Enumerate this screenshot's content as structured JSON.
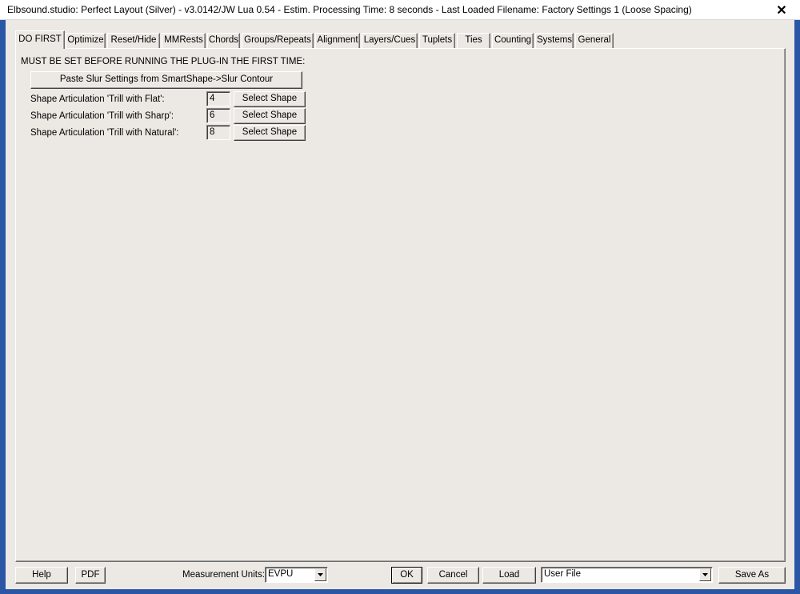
{
  "window": {
    "title": "Elbsound.studio: Perfect Layout (Silver) - v3.0142/JW Lua 0.54 - Estim. Processing Time: 8 seconds - Last Loaded Filename: Factory Settings 1 (Loose Spacing)",
    "close_glyph": "✕"
  },
  "tabs": [
    {
      "label": "DO FIRST",
      "active": true
    },
    {
      "label": "Optimize"
    },
    {
      "label": "Reset/Hide"
    },
    {
      "label": "MMRests"
    },
    {
      "label": "Chords"
    },
    {
      "label": "Groups/Repeats"
    },
    {
      "label": "Alignment"
    },
    {
      "label": "Layers/Cues"
    },
    {
      "label": "Tuplets"
    },
    {
      "label": "Ties"
    },
    {
      "label": "Counting"
    },
    {
      "label": "Systems"
    },
    {
      "label": "General"
    }
  ],
  "panel": {
    "header": "MUST BE SET BEFORE RUNNING THE PLUG-IN THE FIRST TIME:",
    "paste_button": "Paste Slur Settings from SmartShape->Slur Contour",
    "rows": [
      {
        "label": "Shape Articulation 'Trill with Flat':",
        "value": "4",
        "button": "Select Shape"
      },
      {
        "label": "Shape Articulation 'Trill with Sharp':",
        "value": "6",
        "button": "Select Shape"
      },
      {
        "label": "Shape Articulation 'Trill with Natural':",
        "value": "8",
        "button": "Select Shape"
      }
    ]
  },
  "footer": {
    "help": "Help",
    "pdf": "PDF",
    "units_label": "Measurement Units:",
    "units_value": "EVPU",
    "ok": "OK",
    "cancel": "Cancel",
    "load": "Load",
    "file_select": "User File",
    "save_as": "Save As"
  },
  "colors": {
    "frame": "#2b56a5",
    "face": "#ece9e4"
  }
}
